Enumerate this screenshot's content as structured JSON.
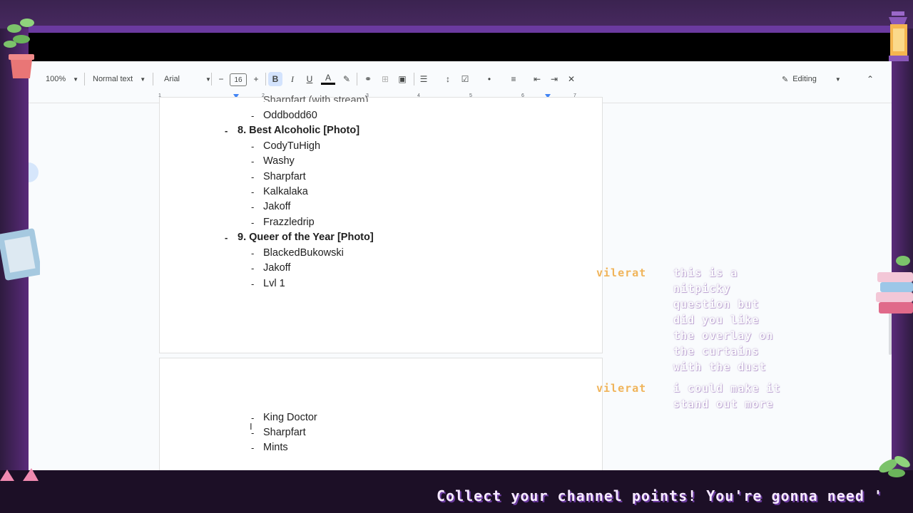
{
  "toolbar": {
    "zoom": "100%",
    "style": "Normal text",
    "font": "Arial",
    "font_size": "16",
    "mode": "Editing",
    "ruler_numbers": [
      "1",
      "2",
      "3",
      "4",
      "5",
      "6",
      "7"
    ]
  },
  "document": {
    "page1": {
      "partial_top_line": "Sharpfart (with stream)",
      "items": [
        {
          "type": "sub",
          "text": "Oddbodd60"
        },
        {
          "type": "category",
          "text": "8. Best Alcoholic [Photo]"
        },
        {
          "type": "sub",
          "text": "CodyTuHigh"
        },
        {
          "type": "sub",
          "text": "Washy"
        },
        {
          "type": "sub",
          "text": "Sharpfart"
        },
        {
          "type": "sub",
          "text": "Kalkalaka"
        },
        {
          "type": "sub",
          "text": "Jakoff"
        },
        {
          "type": "sub",
          "text": "Frazzledrip"
        },
        {
          "type": "category",
          "text": "9. Queer of the Year [Photo]"
        },
        {
          "type": "sub",
          "text": "BlackedBukowski"
        },
        {
          "type": "sub",
          "text": "Jakoff"
        },
        {
          "type": "sub",
          "text": "Lvl 1"
        }
      ]
    },
    "page2": {
      "items": [
        {
          "type": "sub",
          "text": "King Doctor"
        },
        {
          "type": "sub",
          "text": "Sharpfart"
        },
        {
          "type": "sub",
          "text": "Mints"
        }
      ]
    },
    "dash": "-"
  },
  "chat": [
    {
      "user": "vilerat",
      "lines": [
        "this is a",
        "nitpicky",
        "question but",
        "did you like",
        "the overlay on",
        "the curtains",
        "with the dust"
      ]
    },
    {
      "user": "vilerat",
      "lines": [
        "i could make it",
        "stand out more"
      ]
    }
  ],
  "ticker": "Collect your channel points! You're gonna need '",
  "colors": {
    "frame_purple": "#6b3aa0",
    "chat_user": "#f0b45a",
    "accent_blue": "#4285f4"
  }
}
